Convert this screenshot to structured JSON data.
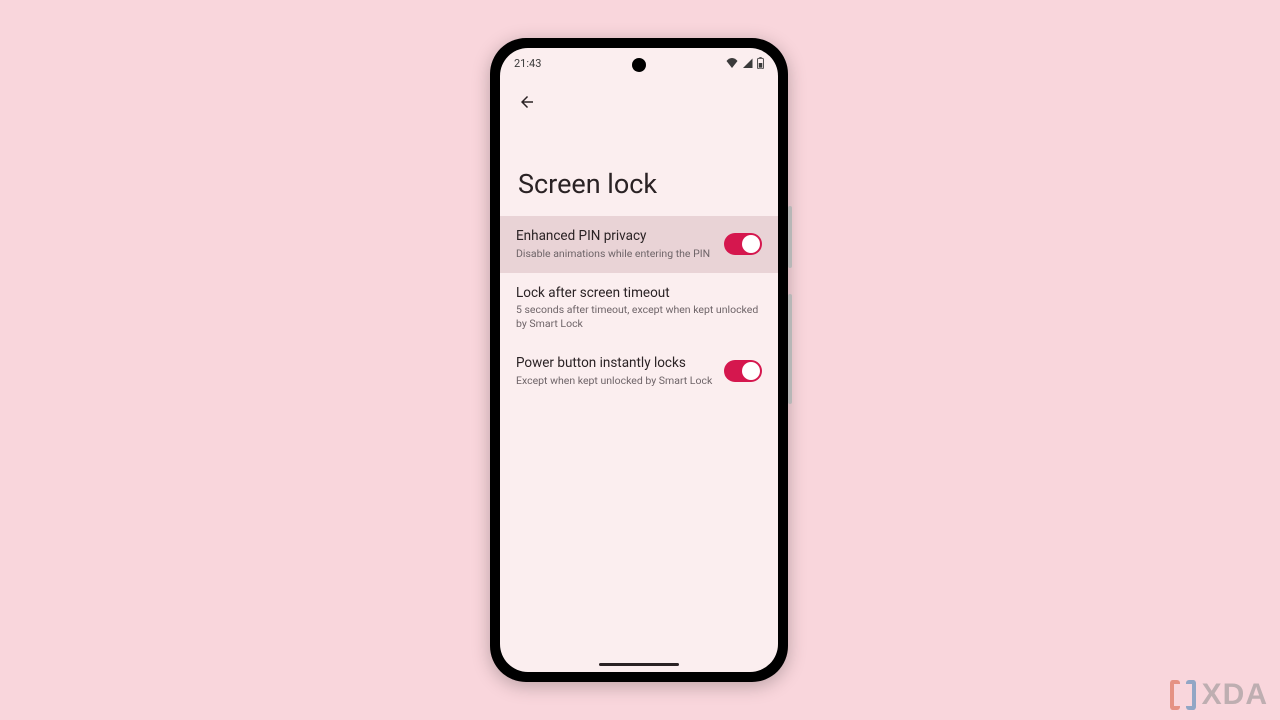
{
  "status": {
    "time": "21:43"
  },
  "page": {
    "title": "Screen lock"
  },
  "settings": {
    "enhanced_pin": {
      "title": "Enhanced PIN privacy",
      "sub": "Disable animations while entering the PIN",
      "on": true
    },
    "lock_after": {
      "title": "Lock after screen timeout",
      "sub": "5 seconds after timeout, except when kept unlocked by Smart Lock"
    },
    "power_lock": {
      "title": "Power button instantly locks",
      "sub": "Except when kept unlocked by Smart Lock",
      "on": true
    }
  },
  "watermark": {
    "text": "XDA"
  }
}
